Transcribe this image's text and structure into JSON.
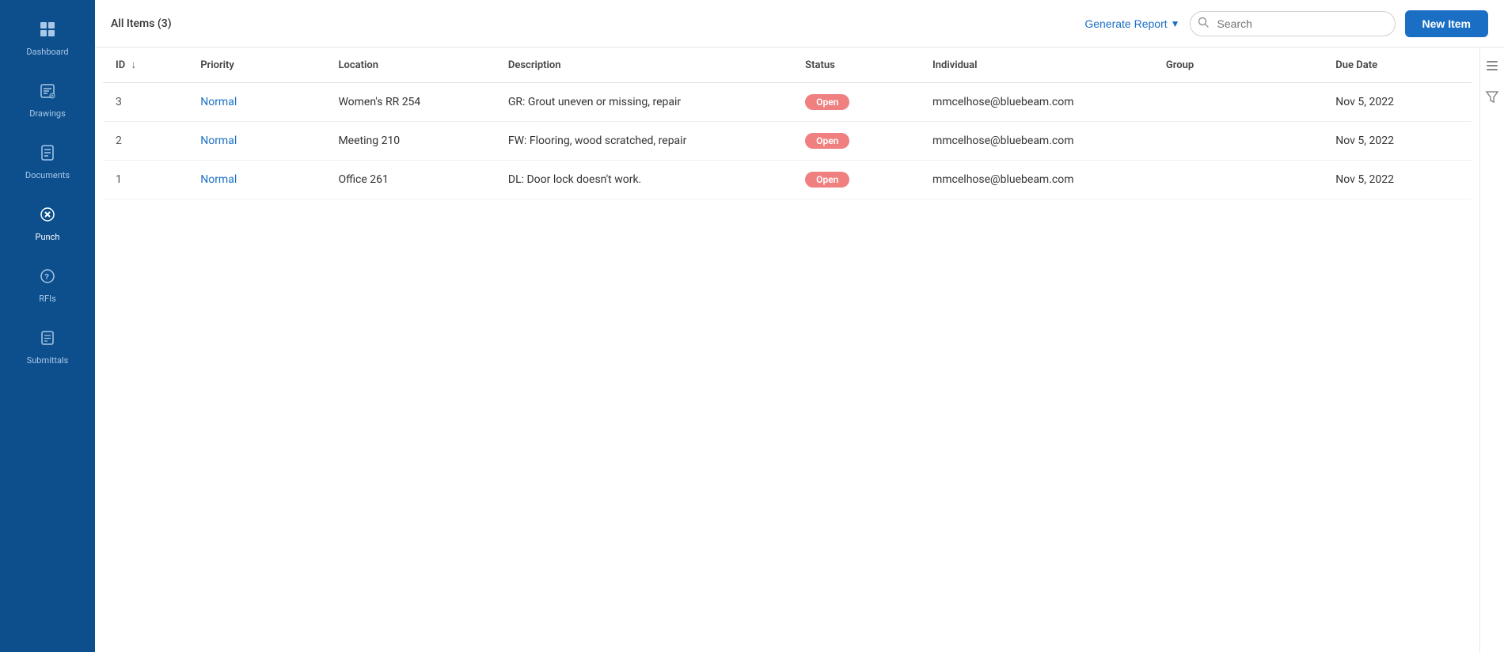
{
  "sidebar": {
    "items": [
      {
        "id": "dashboard",
        "label": "Dashboard",
        "icon": "⊞",
        "active": false
      },
      {
        "id": "drawings",
        "label": "Drawings",
        "icon": "✏️",
        "active": false
      },
      {
        "id": "documents",
        "label": "Documents",
        "icon": "📄",
        "active": false
      },
      {
        "id": "punch",
        "label": "Punch",
        "icon": "🔴",
        "active": true
      },
      {
        "id": "rfis",
        "label": "RFIs",
        "icon": "❓",
        "active": false
      },
      {
        "id": "submittals",
        "label": "Submittals",
        "icon": "📋",
        "active": false
      }
    ]
  },
  "topbar": {
    "title": "All Items (3)",
    "generate_report_label": "Generate Report",
    "search_placeholder": "Search",
    "new_item_label": "New Item"
  },
  "table": {
    "columns": [
      "ID",
      "Priority",
      "Location",
      "Description",
      "Status",
      "Individual",
      "Group",
      "Due Date"
    ],
    "rows": [
      {
        "id": "3",
        "priority": "Normal",
        "location": "Women's RR 254",
        "description": "GR: Grout uneven or missing, repair",
        "status": "Open",
        "individual": "mmcelhose@bluebeam.com",
        "group": "",
        "due_date": "Nov 5, 2022"
      },
      {
        "id": "2",
        "priority": "Normal",
        "location": "Meeting 210",
        "description": "FW: Flooring, wood scratched, repair",
        "status": "Open",
        "individual": "mmcelhose@bluebeam.com",
        "group": "",
        "due_date": "Nov 5, 2022"
      },
      {
        "id": "1",
        "priority": "Normal",
        "location": "Office 261",
        "description": "DL: Door lock doesn't work.",
        "status": "Open",
        "individual": "mmcelhose@bluebeam.com",
        "group": "",
        "due_date": "Nov 5, 2022"
      }
    ]
  },
  "colors": {
    "sidebar_bg": "#0d4f8c",
    "active_color": "#ffffff",
    "inactive_color": "#a8c8e8",
    "accent": "#1a6fc4",
    "open_badge": "#f08080"
  }
}
